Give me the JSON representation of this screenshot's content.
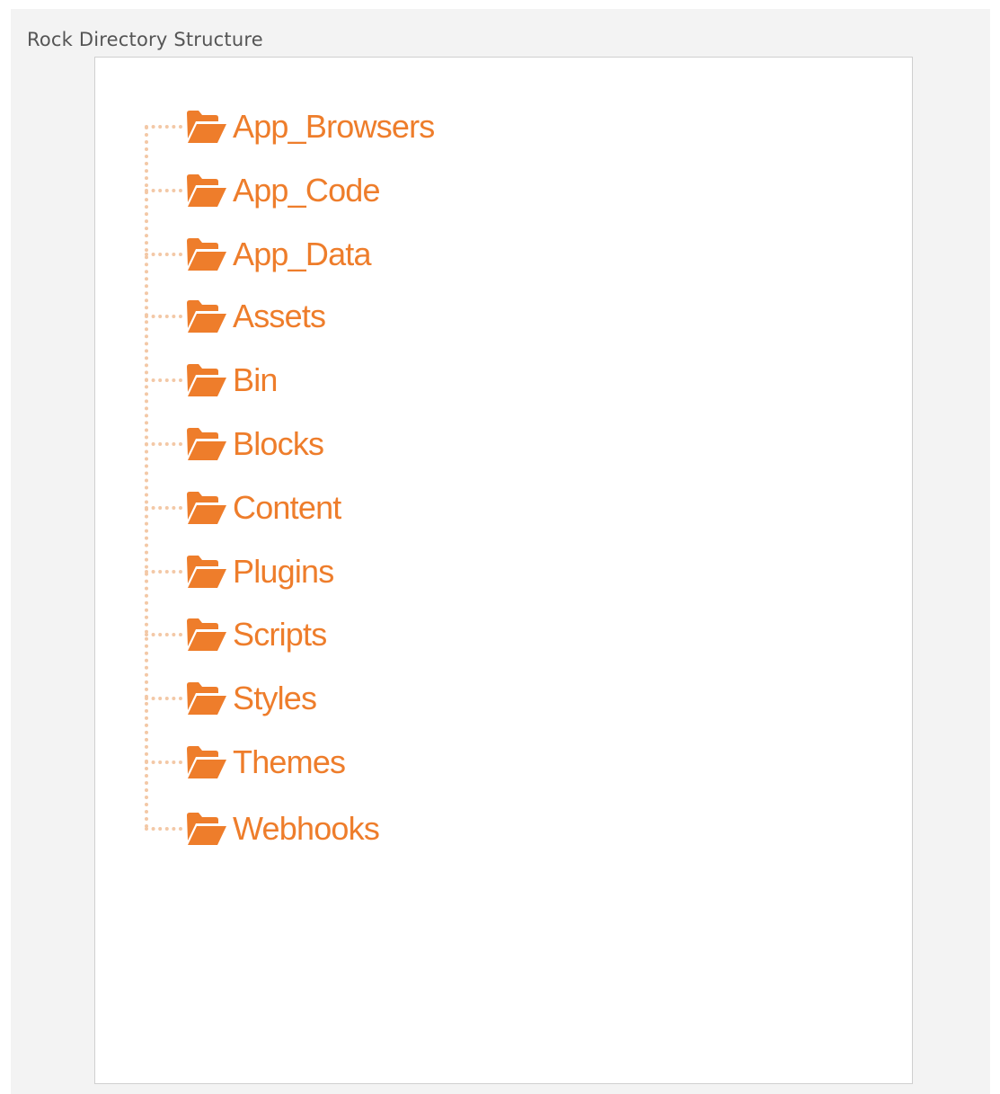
{
  "caption": "Rock Directory Structure",
  "colors": {
    "accent": "#ee7d2b",
    "connector": "#f3c8a6",
    "frame_background": "#f3f3f3",
    "panel_background": "#ffffff",
    "caption_text": "#555555"
  },
  "tree": {
    "icon": "folder-open-icon",
    "items": [
      {
        "label": "App_Browsers"
      },
      {
        "label": "App_Code"
      },
      {
        "label": "App_Data"
      },
      {
        "label": "Assets"
      },
      {
        "label": "Bin"
      },
      {
        "label": "Blocks"
      },
      {
        "label": "Content"
      },
      {
        "label": "Plugins"
      },
      {
        "label": "Scripts"
      },
      {
        "label": "Styles"
      },
      {
        "label": "Themes"
      },
      {
        "label": "Webhooks"
      }
    ]
  }
}
